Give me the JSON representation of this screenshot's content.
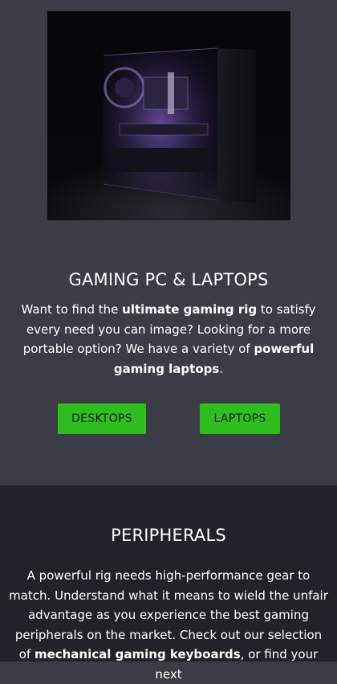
{
  "gaming": {
    "title": "GAMING PC & LAPTOPS",
    "body_1": "Want to find the ",
    "body_bold_1": "ultimate gaming rig",
    "body_2": " to satisfy every need you can image? Looking for a more portable option? We have a variety of ",
    "body_bold_2": "powerful gaming laptops",
    "body_3": ".",
    "desktops_label": "DESKTOPS",
    "laptops_label": "LAPTOPS",
    "accent_color": "#2ebf1f"
  },
  "peripherals": {
    "title": "PERIPHERALS",
    "body_1": "A powerful rig needs high-performance gear to match. Understand what it means to wield the unfair advantage as you experience the best gaming peripherals on the market. Check out our selection of ",
    "body_bold_1": "mechanical gaming keyboards",
    "body_2": ", or find your next"
  }
}
